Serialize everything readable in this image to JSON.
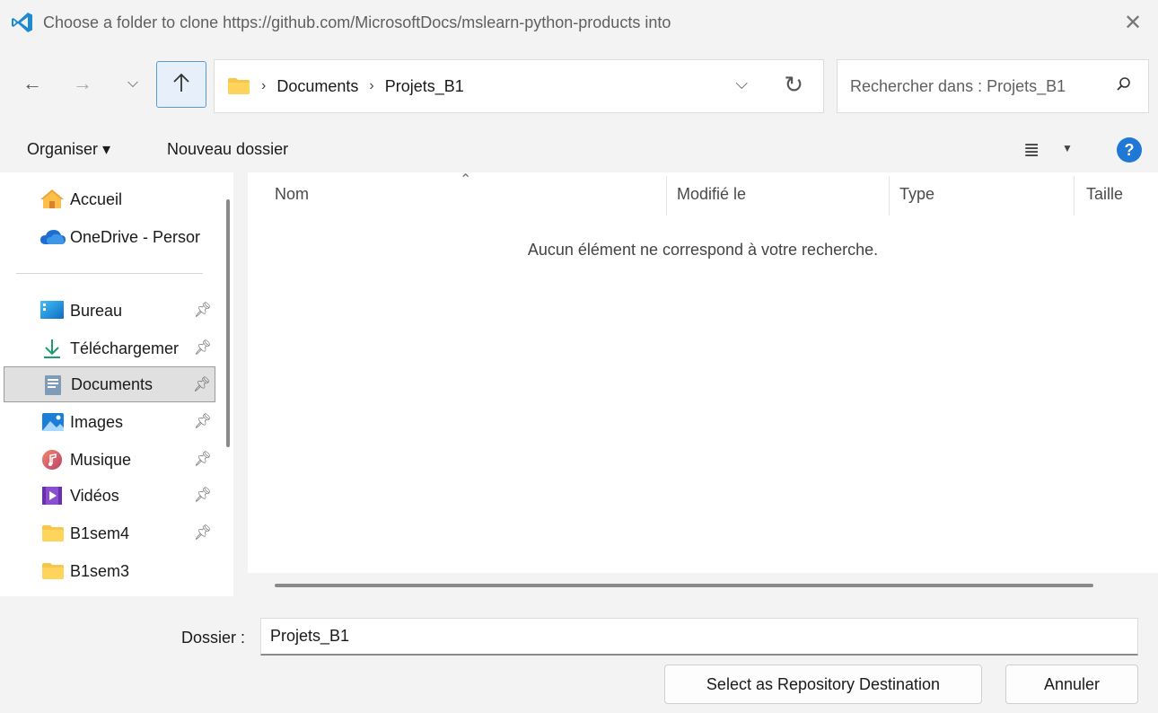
{
  "window": {
    "title": "Choose a folder to clone https://github.com/MicrosoftDocs/mslearn-python-products into",
    "app_icon": "vscode-icon",
    "accent": "#1e78d4"
  },
  "nav": {
    "breadcrumb": [
      "Documents",
      "Projets_B1"
    ],
    "search_placeholder": "Rechercher dans : Projets_B1"
  },
  "toolbar": {
    "organize_label": "Organiser ▾",
    "new_folder_label": "Nouveau dossier"
  },
  "sidebar": {
    "items": [
      {
        "label": "Accueil",
        "icon": "home-icon",
        "pinned": false
      },
      {
        "label": "OneDrive - Persor",
        "icon": "onedrive-cloud-icon",
        "pinned": false
      },
      {
        "label": "Bureau",
        "icon": "desktop-icon",
        "pinned": true
      },
      {
        "label": "Téléchargemer",
        "icon": "download-icon",
        "pinned": true
      },
      {
        "label": "Documents",
        "icon": "documents-icon",
        "pinned": true,
        "selected": true
      },
      {
        "label": "Images",
        "icon": "images-icon",
        "pinned": true
      },
      {
        "label": "Musique",
        "icon": "music-icon",
        "pinned": true
      },
      {
        "label": "Vidéos",
        "icon": "videos-icon",
        "pinned": true
      },
      {
        "label": "B1sem4",
        "icon": "folder-icon",
        "pinned": true
      },
      {
        "label": "B1sem3",
        "icon": "folder-icon",
        "pinned": false
      }
    ]
  },
  "filelist": {
    "columns": [
      "Nom",
      "Modifié le",
      "Type",
      "Taille"
    ],
    "empty_message": "Aucun élément ne correspond à votre recherche."
  },
  "footer": {
    "folder_label": "Dossier :",
    "folder_value": "Projets_B1",
    "primary_button": "Select as Repository Destination",
    "cancel_button": "Annuler"
  }
}
